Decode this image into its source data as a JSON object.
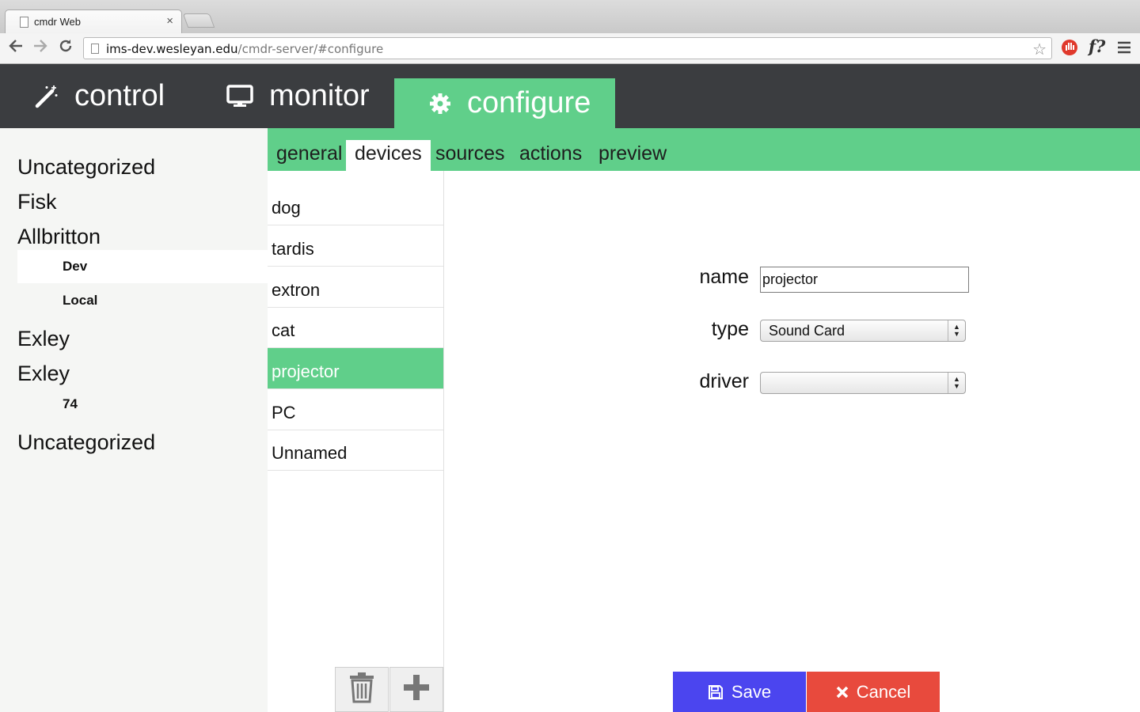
{
  "browser": {
    "tab_title": "cmdr Web",
    "tab_close": "×",
    "url_host": "ims-dev.wesleyan.edu",
    "url_path": "/cmdr-server/#configure",
    "ext_label": "f?"
  },
  "nav": {
    "tabs": [
      {
        "label": "control",
        "icon": "magic-wand-icon"
      },
      {
        "label": "monitor",
        "icon": "monitor-icon"
      },
      {
        "label": "configure",
        "icon": "gear-icon",
        "active": true
      }
    ]
  },
  "subnav": {
    "tabs": [
      "general",
      "devices",
      "sources",
      "actions",
      "preview"
    ],
    "active": "devices"
  },
  "sidebar": {
    "items": [
      {
        "label": "Uncategorized"
      },
      {
        "label": "Fisk"
      },
      {
        "label": "Allbritton"
      },
      {
        "label": "Dev",
        "sub": true,
        "selected": true
      },
      {
        "label": "Local",
        "sub": true
      },
      {
        "label": "Exley"
      },
      {
        "label": "Exley"
      },
      {
        "label": "74",
        "sub": true
      },
      {
        "label": "Uncategorized"
      }
    ]
  },
  "devices": {
    "items": [
      "dog",
      "tardis",
      "extron",
      "cat",
      "projector",
      "PC",
      "Unnamed"
    ],
    "selected": "projector"
  },
  "form": {
    "name_label": "name",
    "name_value": "projector",
    "type_label": "type",
    "type_value": "Sound Card",
    "driver_label": "driver",
    "driver_value": ""
  },
  "buttons": {
    "save": "Save",
    "cancel": "Cancel"
  },
  "colors": {
    "accent_green": "#60cf8a",
    "nav_dark": "#3b3d40",
    "save_blue": "#4b45ef",
    "cancel_red": "#e84a3d"
  }
}
